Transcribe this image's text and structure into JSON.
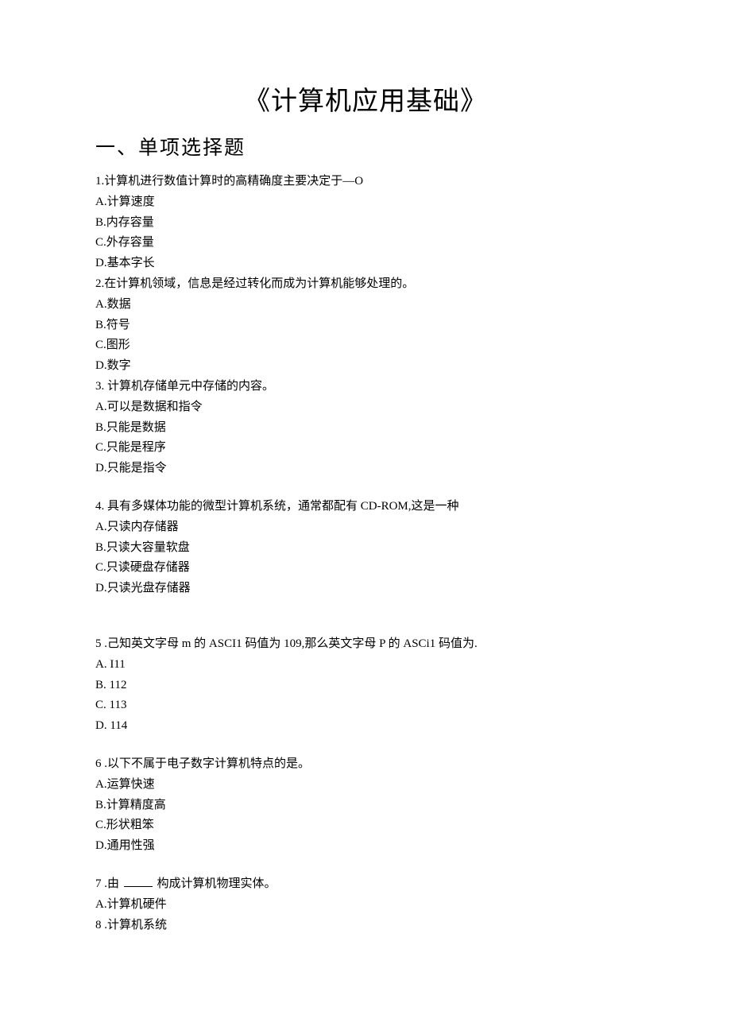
{
  "title": "《计算机应用基础》",
  "section": "一、单项选择题",
  "q1": {
    "stem": "1.计算机进行数值计算时的高精确度主要决定于—O",
    "A": "A.计算速度",
    "B": "B.内存容量",
    "C": "C.外存容量",
    "D": "D.基本字长"
  },
  "q2": {
    "stem": "2.在计算机领域，信息是经过转化而成为计算机能够处理的。",
    "A": "A.数据",
    "B": "B.符号",
    "C": "C.图形",
    "D": "D.数字"
  },
  "q3": {
    "stem": "3. 计算机存储单元中存储的内容。",
    "A": "A.可以是数据和指令",
    "B": "B.只能是数据",
    "C": "C.只能是程序",
    "D": "D.只能是指令"
  },
  "q4": {
    "stem": "4. 具有多媒体功能的微型计算机系统，通常都配有 CD-ROM,这是一种",
    "A": "A.只读内存储器",
    "B": "B.只读大容量软盘",
    "C": "C.只读硬盘存储器",
    "D": "D.只读光盘存储器"
  },
  "q5": {
    "stem": "5    .己知英文字母 m 的 ASCI1 码值为 109,那么英文字母 P 的 ASCi1 码值为.",
    "A": "A.    I11",
    "B": "B.    112",
    "C": "C.    113",
    "D": "D.    114"
  },
  "q6": {
    "stem": "6    .以下不属于电子数字计算机特点的是。",
    "A": "A.运算快速",
    "B": "B.计算精度高",
    "C": "C.形状粗笨",
    "D": "D.通用性强"
  },
  "q7": {
    "stem_prefix": "7    .由 ",
    "stem_suffix": " 构成计算机物理实体。",
    "A": "A.计算机硬件"
  },
  "q8": {
    "stem": "8    .计算机系统"
  }
}
